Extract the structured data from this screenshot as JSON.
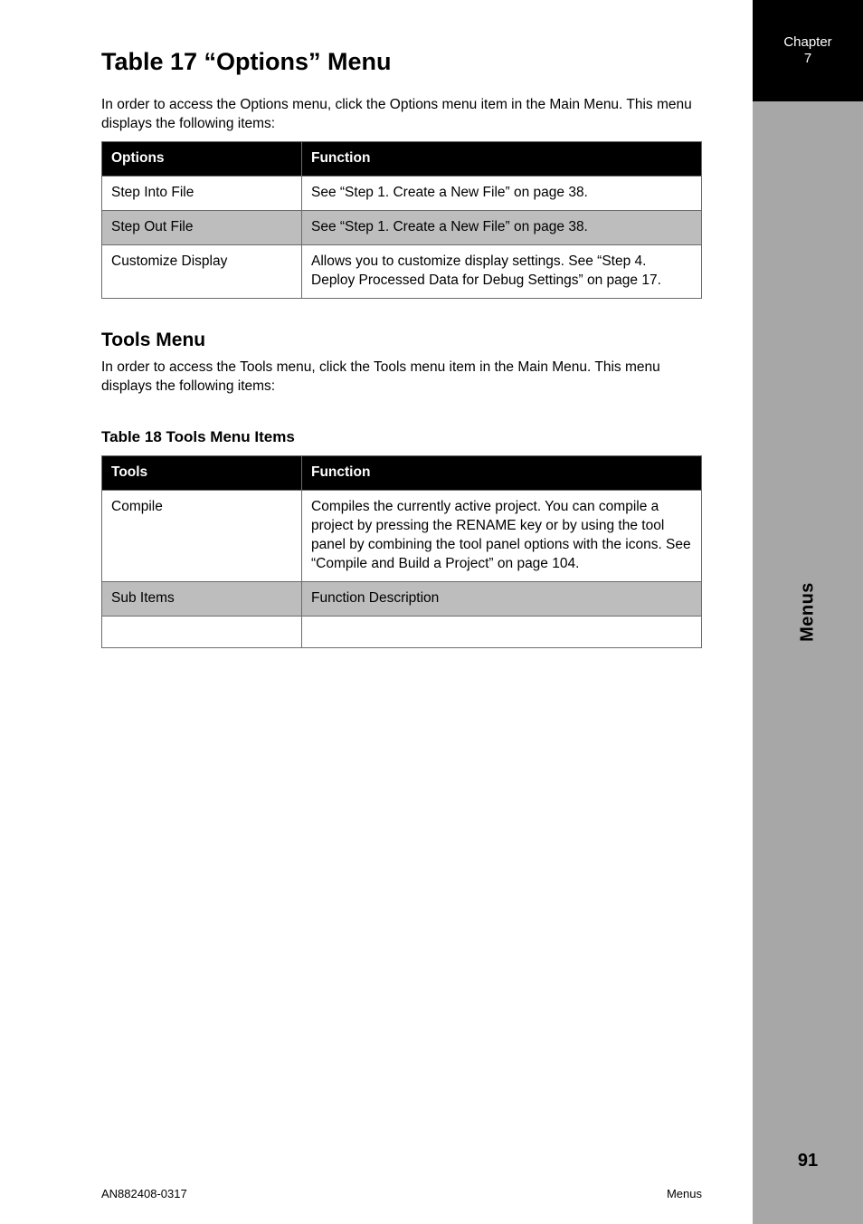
{
  "sidebar": {
    "chapter_line1": "Chapter",
    "chapter_line2": "7",
    "vertical": "Menus"
  },
  "title": "Table 17 “Options” Menu",
  "intro": "In order to access the Options menu, click the Options menu item in the Main Menu. This menu displays the following items:",
  "t1": {
    "h1": "Options",
    "h2": "Function",
    "r1c1": "Step Into File",
    "r1c2": "See “Step 1. Create a New File” on page 38.",
    "r2c1": "Step Out File",
    "r2c2": "See “Step 1. Create a New File” on page 38.",
    "r3c1": "Customize Display",
    "r3c2": "Allows you to customize display settings. See “Step 4. Deploy Processed Data for Debug Settings” on page 17."
  },
  "tools": {
    "heading": "Tools Menu",
    "text": "In order to access the Tools menu, click the Tools menu item in the Main Menu. This menu displays the following items:"
  },
  "t2": {
    "caption": "Table 18 Tools Menu Items",
    "h1": "Tools",
    "h2": "Function",
    "r1c1": "Compile",
    "r1c2": "Compiles the currently active project. You can compile a project by pressing the RENAME key or by using the tool panel by combining the tool panel options with the icons. See “Compile and Build a Project” on page 104.",
    "r2c1": "Sub Items",
    "r2c2": "Function Description",
    "r3c1": "",
    "r3c2": ""
  },
  "footer": {
    "left": "AN882408-0317",
    "right": "Menus"
  },
  "pageNumber": "91"
}
